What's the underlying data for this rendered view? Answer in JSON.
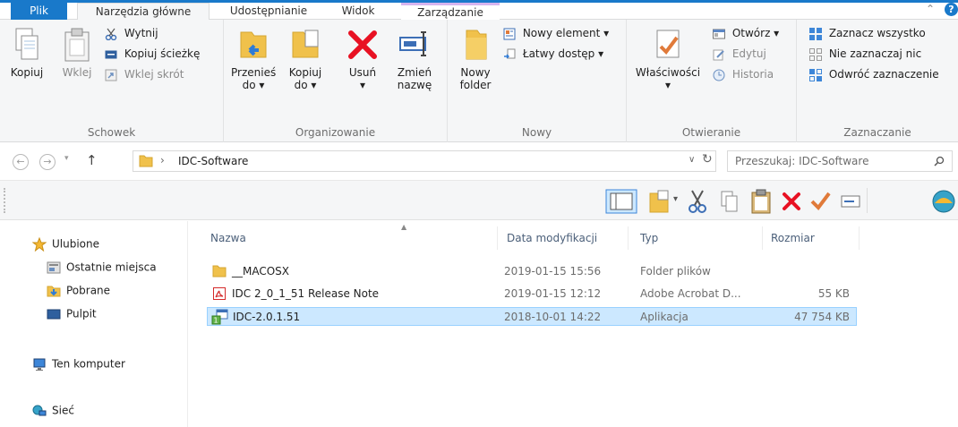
{
  "ribbon_tabs": {
    "file": "Plik",
    "home": "Narzędzia główne",
    "share": "Udostępnianie",
    "view": "Widok",
    "manage": "Zarządzanie"
  },
  "help_label": "?",
  "groups": {
    "clipboard": {
      "label": "Schowek",
      "copy": "Kopiuj",
      "paste": "Wklej",
      "cut": "Wytnij",
      "copy_path": "Kopiuj ścieżkę",
      "paste_shortcut": "Wklej skrót"
    },
    "organize": {
      "label": "Organizowanie",
      "move_to_1": "Przenieś",
      "move_to_2": "do ▾",
      "copy_to_1": "Kopiuj",
      "copy_to_2": "do ▾",
      "delete": "Usuń",
      "delete_arrow": "▾",
      "rename_1": "Zmień",
      "rename_2": "nazwę"
    },
    "new": {
      "label": "Nowy",
      "new_folder_1": "Nowy",
      "new_folder_2": "folder",
      "new_item": "Nowy element ▾",
      "easy_access": "Łatwy dostęp ▾"
    },
    "open": {
      "label": "Otwieranie",
      "properties": "Właściwości",
      "properties_arrow": "▾",
      "open": "Otwórz ▾",
      "edit": "Edytuj",
      "history": "Historia"
    },
    "select": {
      "label": "Zaznaczanie",
      "select_all": "Zaznacz wszystko",
      "select_none": "Nie zaznaczaj nic",
      "invert": "Odwróć zaznaczenie"
    }
  },
  "address": {
    "path_sep": "›",
    "current": "IDC-Software",
    "search_placeholder": "Przeszukaj: IDC-Software"
  },
  "nav_pane": {
    "favorites": "Ulubione",
    "recent": "Ostatnie miejsca",
    "downloads": "Pobrane",
    "desktop": "Pulpit",
    "this_pc": "Ten komputer",
    "network": "Sieć"
  },
  "columns": {
    "name": "Nazwa",
    "modified": "Data modyfikacji",
    "type": "Typ",
    "size": "Rozmiar"
  },
  "files": [
    {
      "name": "__MACOSX",
      "modified": "2019-01-15 15:56",
      "type": "Folder plików",
      "size": ""
    },
    {
      "name": "IDC 2_0_1_51 Release Note",
      "modified": "2019-01-15 12:12",
      "type": "Adobe Acrobat D...",
      "size": "55 KB"
    },
    {
      "name": "IDC-2.0.1.51",
      "modified": "2018-10-01 14:22",
      "type": "Aplikacja",
      "size": "47 754 KB"
    }
  ],
  "colors": {
    "accent": "#1979ca",
    "selection": "#cce8ff",
    "folder": "#f0c14b",
    "delete_red": "#e81123"
  }
}
